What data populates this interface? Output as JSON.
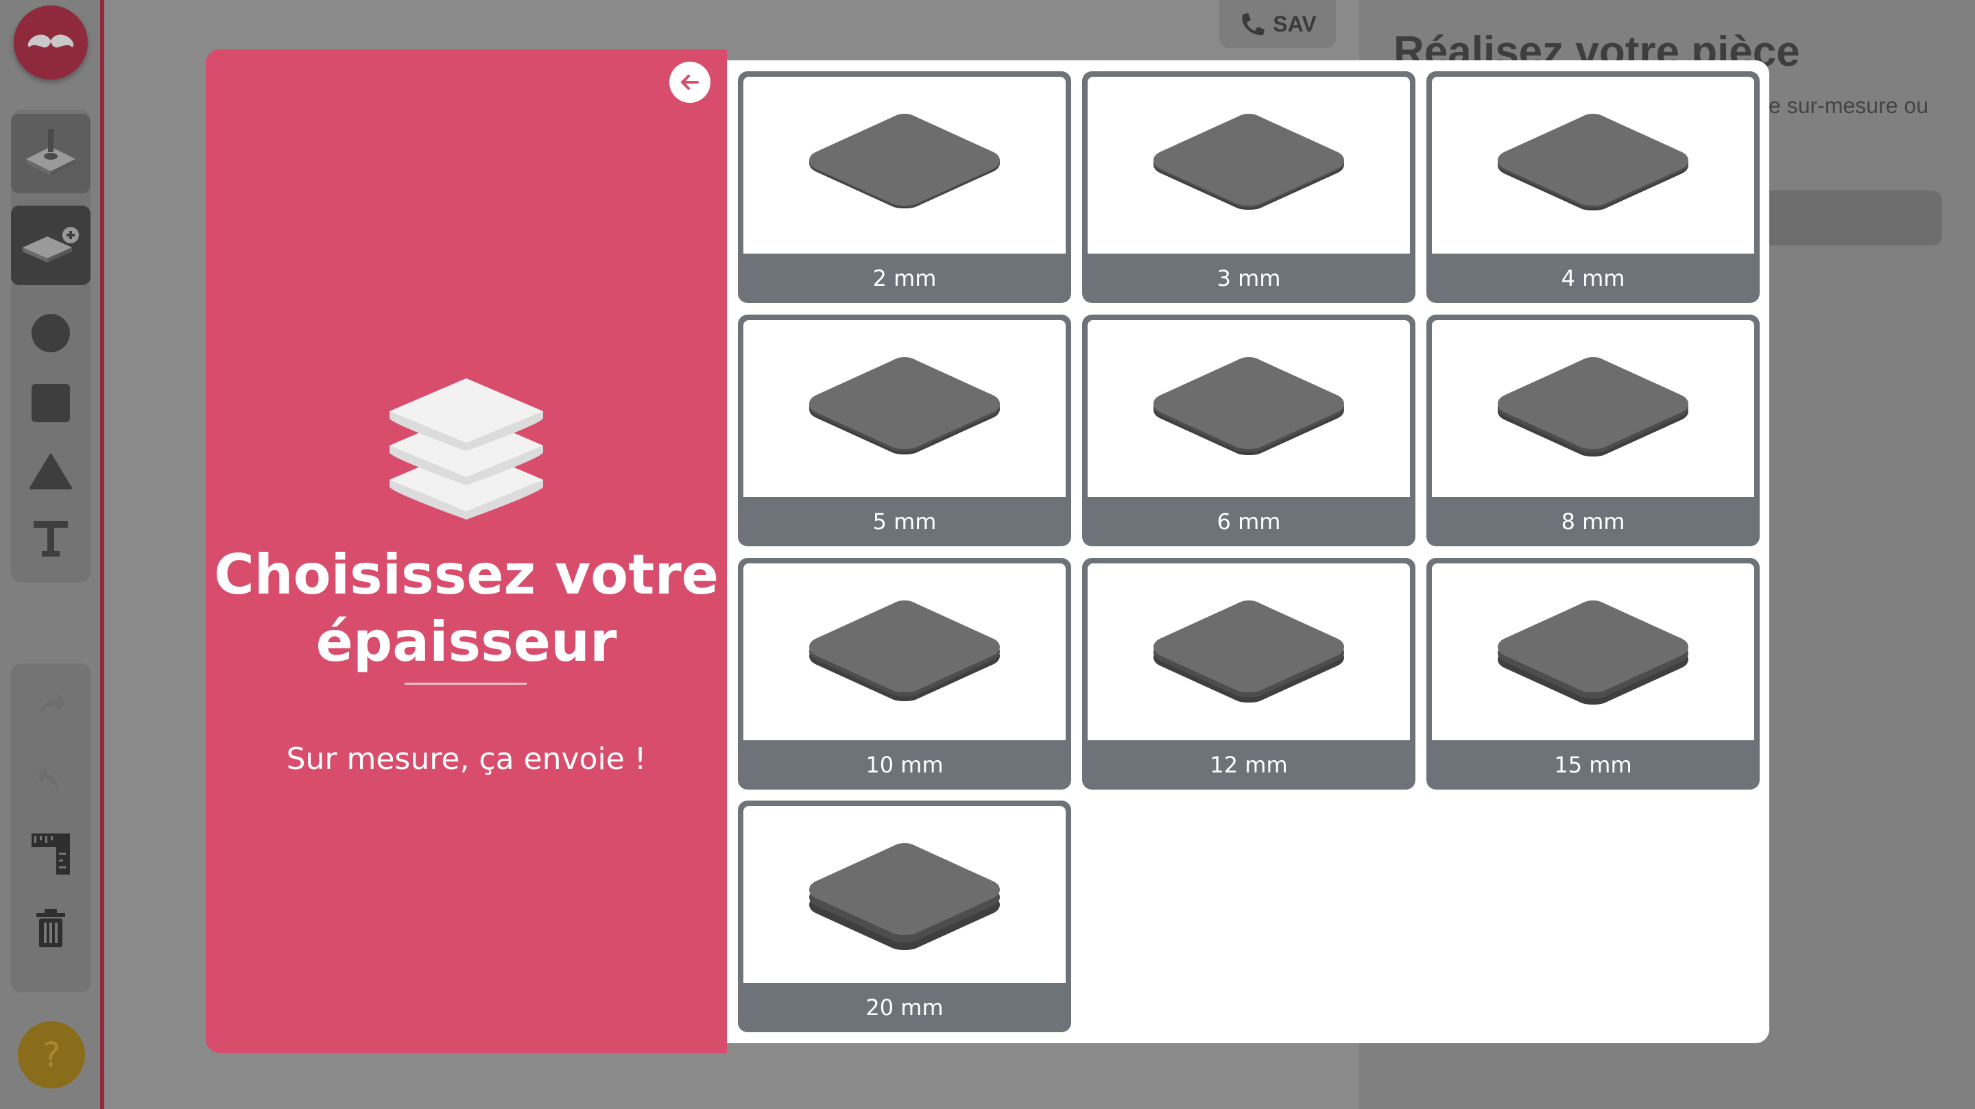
{
  "header": {
    "sav_label": "SAV"
  },
  "right_panel": {
    "title": "Réalisez votre pièce",
    "subtitle": "e sur-mesure ou"
  },
  "sidebar": {
    "tools": [
      "cnc-icon",
      "add-plate-icon",
      "circle-icon",
      "square-icon",
      "triangle-icon",
      "text-icon"
    ],
    "actions": [
      "redo-icon",
      "undo-icon",
      "ruler-icon",
      "trash-icon"
    ],
    "help_label": "?"
  },
  "modal": {
    "title_line1": "Choisissez votre",
    "title_line2": "épaisseur",
    "subtitle": "Sur mesure, ça envoie !",
    "options": [
      {
        "label": "2 mm"
      },
      {
        "label": "3 mm"
      },
      {
        "label": "4 mm"
      },
      {
        "label": "5 mm"
      },
      {
        "label": "6 mm"
      },
      {
        "label": "8 mm"
      },
      {
        "label": "10 mm"
      },
      {
        "label": "12 mm"
      },
      {
        "label": "15 mm"
      },
      {
        "label": "20 mm"
      }
    ]
  },
  "colors": {
    "brand_pink": "#d84c6c",
    "tile_gray": "#6e737a",
    "plate_gray": "#6d6d6d"
  }
}
